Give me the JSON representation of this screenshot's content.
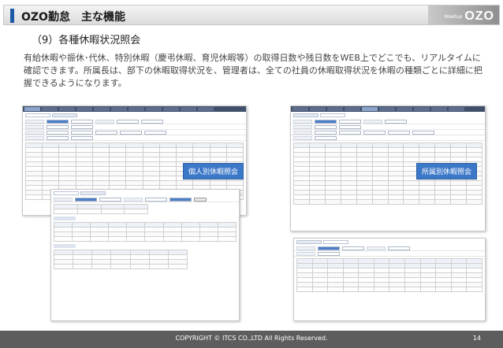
{
  "header": {
    "title": "OZO勤怠　主な機能",
    "brand_small": "Meetup",
    "brand_big": "OZO"
  },
  "section": {
    "title": "（9）各種休暇状況照会"
  },
  "description": "有給休暇や振休･代休、特別休暇（慶弔休暇、育児休暇等）の取得日数や残日数をWEB上でどこでも、リアルタイムに確認できます。所属長は、部下の休暇取得状況を、管理者は、全ての社員の休暇取得状況を休暇の種類ごとに詳細に把握できるようになります。",
  "callouts": {
    "individual": "個人別休暇照会",
    "department": "所属別休暇照会"
  },
  "footer": {
    "copyright": "COPYRIGHT © ITCS CO.,LTD All Rights Reserved.",
    "page": "14"
  }
}
